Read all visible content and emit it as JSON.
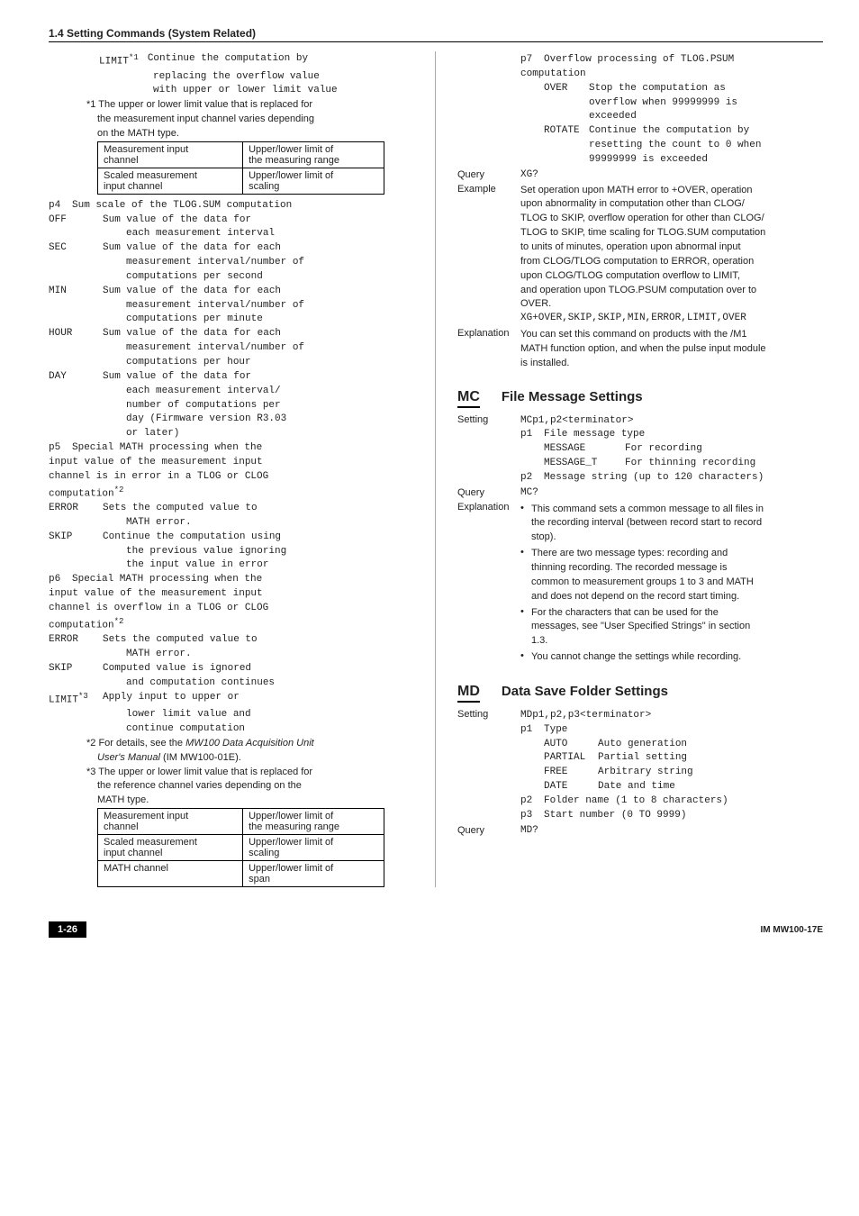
{
  "section_title": "1.4  Setting Commands (System Related)",
  "left": {
    "limit_head": {
      "label": "LIMIT",
      "sup": "*1",
      "l1": "Continue the computation by",
      "l2": "replacing the overflow value",
      "l3": "with upper or lower limit value"
    },
    "note1": {
      "a": "*1 The upper or lower limit value that is replaced for",
      "b": "the measurement input channel varies depending",
      "c": "on the MATH type."
    },
    "tbl1": {
      "r1c1a": "Measurement input",
      "r1c1b": "channel",
      "r1c2a": "Upper/lower limit of",
      "r1c2b": "the measuring range",
      "r2c1a": "Scaled measurement",
      "r2c1b": "input channel",
      "r2c2a": "Upper/lower limit of",
      "r2c2b": "scaling"
    },
    "p4": {
      "code": "p4",
      "title": "Sum scale of the TLOG.SUM computation",
      "off": {
        "k": "OFF",
        "l1": "Sum value of the data for",
        "l2": "each measurement interval"
      },
      "sec": {
        "k": "SEC",
        "l1": "Sum value of the data for each",
        "l2": "measurement interval/number of",
        "l3": "computations per second"
      },
      "min": {
        "k": "MIN",
        "l1": "Sum value of the data for each",
        "l2": "measurement interval/number of",
        "l3": "computations per minute"
      },
      "hour": {
        "k": "HOUR",
        "l1": "Sum value of the data for each",
        "l2": "measurement interval/number of",
        "l3": "computations per hour"
      },
      "day": {
        "k": "DAY",
        "l1": "Sum value of the data for",
        "l2": "each measurement interval/",
        "l3": "number of computations per",
        "l4": "day (Firmware version R3.03",
        "l5": "or later)"
      }
    },
    "p5": {
      "code": "p5",
      "t1": "Special MATH processing when the",
      "t2": "input value of the measurement input",
      "t3": "channel is in error in a TLOG or CLOG",
      "t4a": "computation",
      "t4sup": "*2",
      "err": {
        "k": "ERROR",
        "l1": "Sets the computed value to",
        "l2": "MATH error."
      },
      "skip": {
        "k": "SKIP",
        "l1": "Continue the computation using",
        "l2": "the previous value ignoring",
        "l3": "the input value in error"
      }
    },
    "p6": {
      "code": "p6",
      "t1": "Special MATH processing when the",
      "t2": "input value of the measurement input",
      "t3": "channel is overflow in a TLOG or CLOG",
      "t4a": "computation",
      "t4sup": "*2",
      "err": {
        "k": "ERROR",
        "l1": "Sets the computed value to",
        "l2": "MATH error."
      },
      "skip": {
        "k": "SKIP",
        "l1": "Computed value is ignored",
        "l2": "and computation continues"
      },
      "lim": {
        "k": "LIMIT",
        "ksup": "*3",
        "l1": "Apply input to upper or",
        "l2": "lower limit value and",
        "l3": "continue computation"
      }
    },
    "note2": {
      "a": "*2 For details, see the ",
      "b": "MW100 Data Acquisition Unit",
      "c": "User's Manual",
      "d": " (IM MW100-01E)."
    },
    "note3": {
      "a": "*3 The upper or lower limit value that is replaced for",
      "b": "the reference channel varies depending on the",
      "c": "MATH type."
    },
    "tbl2": {
      "r1c1a": "Measurement input",
      "r1c1b": "channel",
      "r1c2a": "Upper/lower limit of",
      "r1c2b": "the measuring range",
      "r2c1a": "Scaled measurement",
      "r2c1b": "input channel",
      "r2c2a": "Upper/lower limit of",
      "r2c2b": "scaling",
      "r3c1": "MATH channel",
      "r3c2a": "Upper/lower limit of",
      "r3c2b": "span"
    }
  },
  "right": {
    "p7": {
      "code": "p7",
      "t1": "Overflow processing of TLOG.PSUM",
      "t2": "computation",
      "over": {
        "k": "OVER",
        "l1": "Stop the computation as",
        "l2": "overflow when 99999999 is",
        "l3": "exceeded"
      },
      "rot": {
        "k": "ROTATE",
        "l1": "Continue the computation by",
        "l2": "resetting the count to 0 when",
        "l3": "99999999 is exceeded"
      }
    },
    "query": {
      "label": "Query",
      "value": "XG?"
    },
    "example": {
      "label": "Example",
      "l1": "Set operation upon MATH error to +OVER, operation",
      "l2": "upon abnormality in computation other than CLOG/",
      "l3": "TLOG to SKIP, overflow operation for other than CLOG/",
      "l4": "TLOG to SKIP, time scaling for TLOG.SUM computation",
      "l5": "to units of minutes, operation upon abnormal input",
      "l6": "from CLOG/TLOG computation to ERROR, operation",
      "l7": "upon CLOG/TLOG computation overflow to LIMIT,",
      "l8": "and operation upon TLOG.PSUM computation over to",
      "l9": "OVER.",
      "code": "XG+OVER,SKIP,SKIP,MIN,ERROR,LIMIT,OVER"
    },
    "expl1": {
      "label": "Explanation",
      "l1": "You can set this command on products with the /M1",
      "l2": "MATH function option, and when the pulse input module",
      "l3": "is installed."
    },
    "mc": {
      "code": "MC",
      "title": "File Message Settings",
      "setting_label": "Setting",
      "setting_val": "MCp1,p2<terminator>",
      "p1": {
        "code": "p1",
        "title": "File message type",
        "o1": {
          "k": "MESSAGE",
          "l": "For recording"
        },
        "o2": {
          "k": "MESSAGE_T",
          "l": "For thinning recording"
        }
      },
      "p2": {
        "code": "p2",
        "title": "Message string (up to 120 characters)"
      },
      "query_label": "Query",
      "query_val": "MC?",
      "expl_label": "Explanation",
      "b1": {
        "l1": "This command sets a common message to all files in",
        "l2": "the recording interval (between record start to record",
        "l3": "stop)."
      },
      "b2": {
        "l1": "There are two message types: recording and",
        "l2": "thinning recording. The recorded message is",
        "l3": "common to measurement groups 1 to 3 and MATH",
        "l4": "and does not depend on the record start timing."
      },
      "b3": {
        "l1": "For the characters that can be used for the",
        "l2": "messages, see \"User Specified Strings\" in section",
        "l3": "1.3."
      },
      "b4": {
        "l1": "You cannot change the settings while recording."
      }
    },
    "md": {
      "code": "MD",
      "title": "Data Save Folder Settings",
      "setting_label": "Setting",
      "setting_val": "MDp1,p2,p3<terminator>",
      "p1": {
        "code": "p1",
        "title": "Type",
        "o1": {
          "k": "AUTO",
          "l": "Auto generation"
        },
        "o2": {
          "k": "PARTIAL",
          "l": "Partial setting"
        },
        "o3": {
          "k": "FREE",
          "l": "Arbitrary string"
        },
        "o4": {
          "k": "DATE",
          "l": "Date and time"
        }
      },
      "p2": {
        "code": "p2",
        "title": "Folder name (1 to 8 characters)"
      },
      "p3": {
        "code": "p3",
        "title": "Start number (0 TO 9999)"
      },
      "query_label": "Query",
      "query_val": "MD?"
    }
  },
  "footer": {
    "left": "1-26",
    "right": "IM MW100-17E"
  }
}
